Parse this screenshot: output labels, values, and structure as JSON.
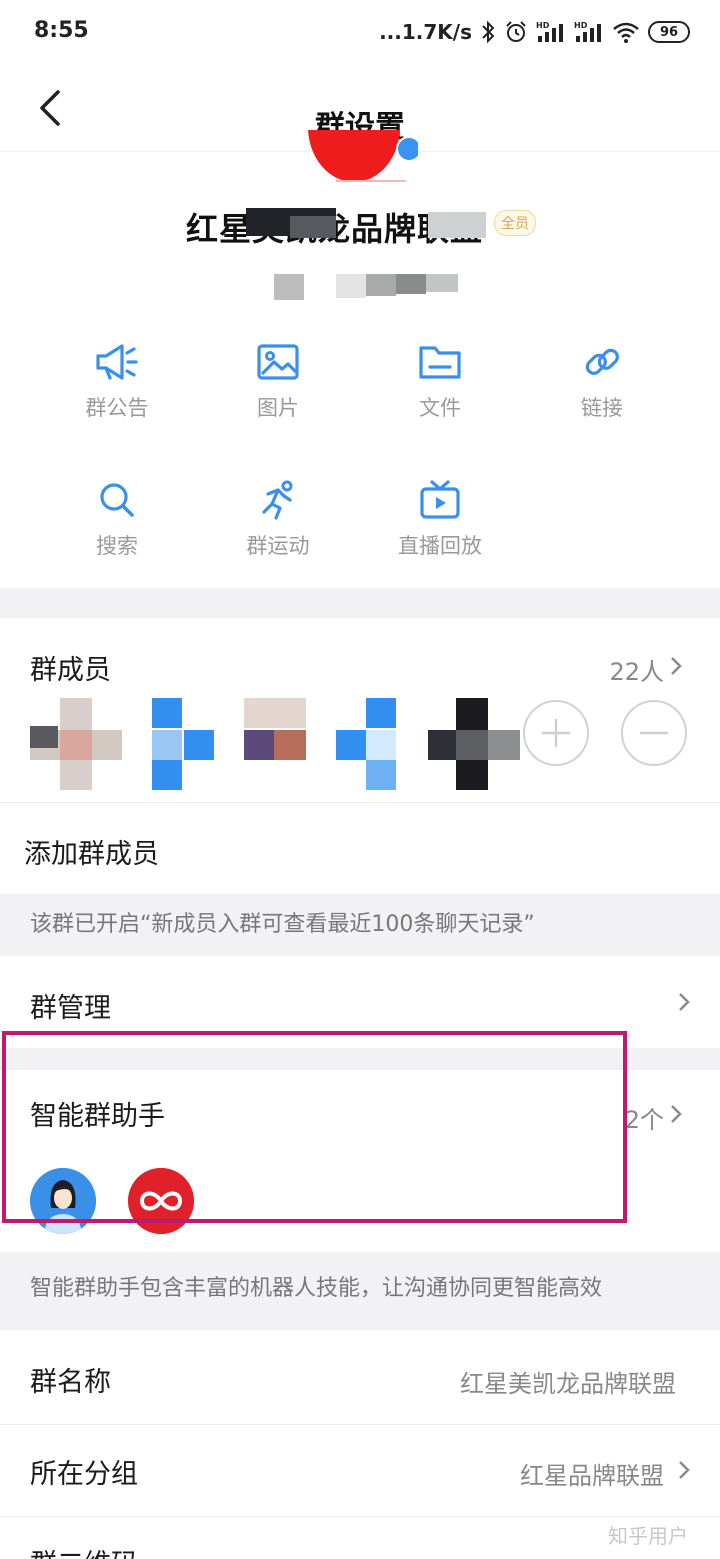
{
  "status_bar": {
    "time": "8:55",
    "speed": "...1.7K/s",
    "battery": "96"
  },
  "header": {
    "title": "群设置"
  },
  "group": {
    "name_visible": "红星美凯龙品牌联盟",
    "tag": "全员",
    "avatar_color": "#ee1c1c"
  },
  "shortcuts": [
    {
      "label": "群公告",
      "icon": "megaphone-icon"
    },
    {
      "label": "图片",
      "icon": "image-icon"
    },
    {
      "label": "文件",
      "icon": "folder-icon"
    },
    {
      "label": "链接",
      "icon": "link-icon"
    },
    {
      "label": "搜索",
      "icon": "search-icon"
    },
    {
      "label": "群运动",
      "icon": "running-icon"
    },
    {
      "label": "直播回放",
      "icon": "tv-icon"
    }
  ],
  "members": {
    "title": "群成员",
    "count": "22人"
  },
  "add_members": {
    "label": "添加群成员",
    "hint": "该群已开启“新成员入群可查看最近100条聊天记录”"
  },
  "group_manage": {
    "label": "群管理"
  },
  "assistant": {
    "label": "智能群助手",
    "count": "2个",
    "hint": "智能群助手包含丰富的机器人技能，让沟通协同更智能高效"
  },
  "group_name_row": {
    "label": "群名称",
    "value": "红星美凯龙品牌联盟"
  },
  "group_category": {
    "label": "所在分组",
    "value": "红星品牌联盟"
  },
  "qr_row": {
    "label": "群二维码"
  },
  "watermark": "知乎用户",
  "colors": {
    "accent": "#3a8fe8",
    "highlight": "#c01a6e"
  }
}
